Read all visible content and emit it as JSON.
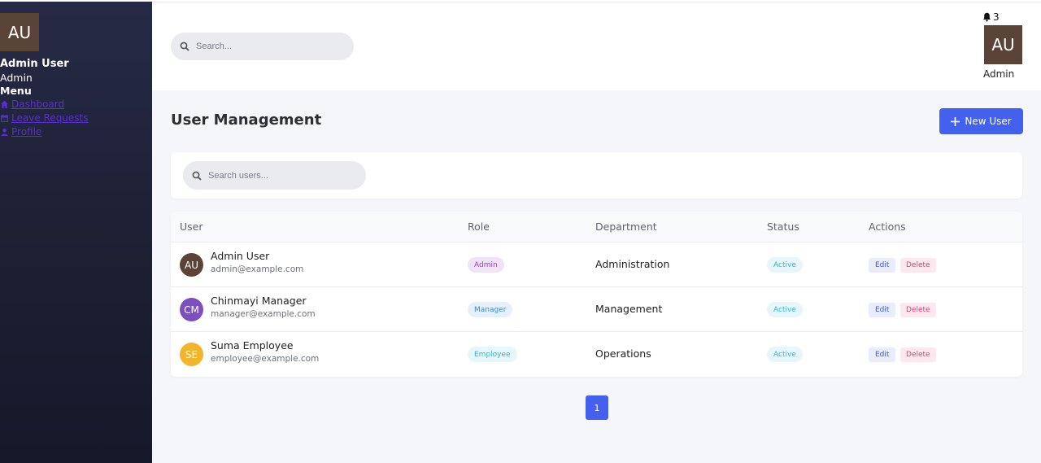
{
  "sidebar": {
    "avatar_initials": "AU",
    "user_name": "Admin User",
    "user_role": "Admin",
    "menu_title": "Menu",
    "items": [
      {
        "label": "Dashboard",
        "icon": "home-icon"
      },
      {
        "label": "Leave Requests",
        "icon": "calendar-icon"
      },
      {
        "label": "Profile",
        "icon": "user-icon"
      }
    ]
  },
  "header": {
    "search_placeholder": "Search...",
    "notification_count": "3",
    "avatar_initials": "AU",
    "role": "Admin"
  },
  "main": {
    "title": "User Management",
    "new_user_label": "New User",
    "user_search_placeholder": "Search users...",
    "columns": [
      "User",
      "Role",
      "Department",
      "Status",
      "Actions"
    ],
    "users": [
      {
        "initials": "AU",
        "name": "Admin User",
        "email": "admin@example.com",
        "role": "Admin",
        "department": "Administration",
        "status": "Active",
        "avatar_color": "#5b4338"
      },
      {
        "initials": "CM",
        "name": "Chinmayi Manager",
        "email": "manager@example.com",
        "role": "Manager",
        "department": "Management",
        "status": "Active",
        "avatar_color": "#7b4fbf"
      },
      {
        "initials": "SE",
        "name": "Suma Employee",
        "email": "employee@example.com",
        "role": "Employee",
        "department": "Operations",
        "status": "Active",
        "avatar_color": "#f2b42b"
      }
    ],
    "edit_label": "Edit",
    "delete_label": "Delete",
    "current_page": "1"
  },
  "colors": {
    "accent": "#4361ee",
    "admin_badge_bg": "#f1e3f7",
    "admin_badge_text": "#9c3ec2",
    "manager_badge_bg": "#e6f0fb",
    "manager_badge_text": "#3f8ad6",
    "employee_badge_bg": "#e6f6fa",
    "employee_badge_text": "#34b7d3"
  }
}
